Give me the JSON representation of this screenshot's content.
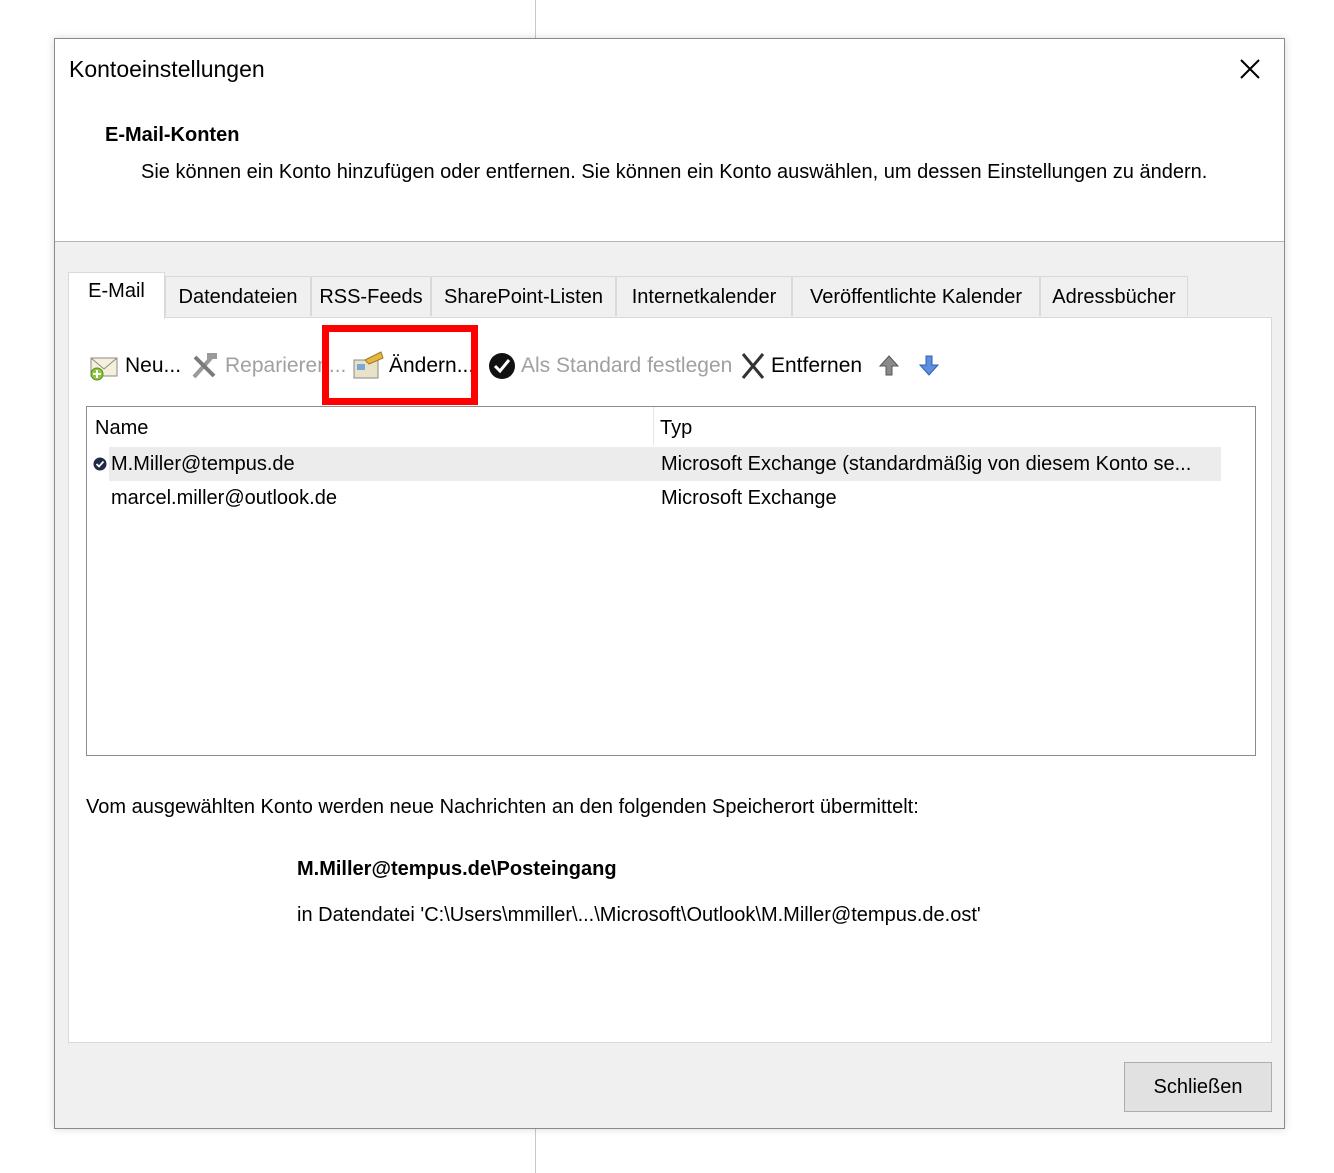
{
  "dialog": {
    "title": "Kontoeinstellungen",
    "section_title": "E-Mail-Konten",
    "section_desc": "Sie können ein Konto hinzufügen oder entfernen. Sie können ein Konto auswählen, um dessen Einstellungen zu ändern."
  },
  "tabs": [
    {
      "label": "E-Mail",
      "active": true
    },
    {
      "label": "Datendateien"
    },
    {
      "label": "RSS-Feeds"
    },
    {
      "label": "SharePoint-Listen"
    },
    {
      "label": "Internetkalender"
    },
    {
      "label": "Veröffentlichte Kalender"
    },
    {
      "label": "Adressbücher"
    }
  ],
  "toolbar": {
    "new_label": "Neu...",
    "repair_label": "Reparieren...",
    "change_label": "Ändern...",
    "default_label": "Als Standard festlegen",
    "remove_label": "Entfernen",
    "move_up_icon": "arrow-up-icon",
    "move_down_icon": "arrow-down-icon"
  },
  "accounts": {
    "columns": [
      "Name",
      "Typ"
    ],
    "rows": [
      {
        "name": "M.Miller@tempus.de",
        "type": "Microsoft Exchange (standardmäßig von diesem Konto se...",
        "default": true,
        "selected": true
      },
      {
        "name": "marcel.miller@outlook.de",
        "type": "Microsoft Exchange",
        "default": false,
        "selected": false
      }
    ]
  },
  "delivery": {
    "text": "Vom ausgewählten Konto werden neue Nachrichten an den folgenden Speicherort übermittelt:",
    "path": "M.Miller@tempus.de\\Posteingang",
    "file": "in Datendatei 'C:\\Users\\mmiller\\...\\Microsoft\\Outlook\\M.Miller@tempus.de.ost'"
  },
  "buttons": {
    "close_label": "Schließen"
  },
  "colors": {
    "highlight": "#ff0000",
    "selected_row": "#ececec",
    "disabled_text": "#a0a0a0"
  }
}
